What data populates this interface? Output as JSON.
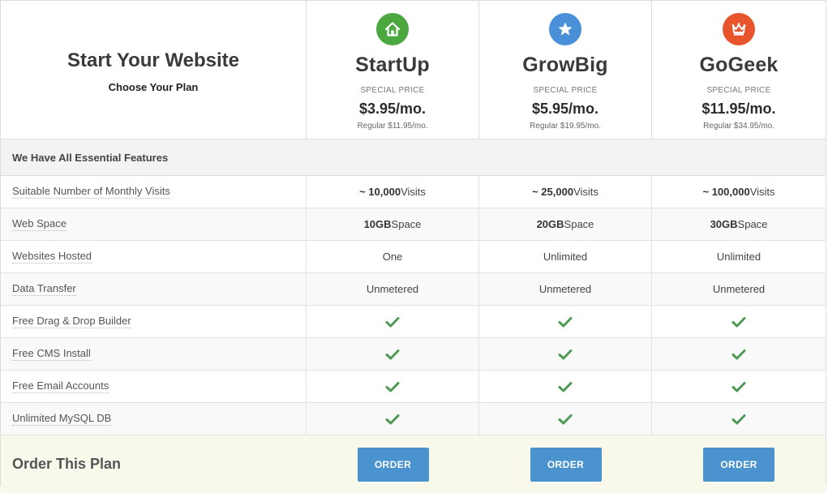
{
  "header": {
    "title": "Start Your Website",
    "subtitle": "Choose Your Plan"
  },
  "plans": [
    {
      "name": "StartUp",
      "icon": "house-icon",
      "icon_color": "#4aa83f",
      "special_label": "SPECIAL PRICE",
      "price": "$3.95/mo.",
      "regular": "Regular $11.95/mo."
    },
    {
      "name": "GrowBig",
      "icon": "star-icon",
      "icon_color": "#4a90d9",
      "special_label": "SPECIAL PRICE",
      "price": "$5.95/mo.",
      "regular": "Regular $19.95/mo."
    },
    {
      "name": "GoGeek",
      "icon": "crown-icon",
      "icon_color": "#e8542c",
      "special_label": "SPECIAL PRICE",
      "price": "$11.95/mo.",
      "regular": "Regular $34.95/mo."
    }
  ],
  "section_title": "We Have All Essential Features",
  "features": [
    {
      "label": "Suitable Number of Monthly Visits",
      "values": [
        {
          "bold": "~ 10,000",
          "rest": " Visits"
        },
        {
          "bold": "~ 25,000",
          "rest": " Visits"
        },
        {
          "bold": "~ 100,000",
          "rest": " Visits"
        }
      ]
    },
    {
      "label": "Web Space",
      "values": [
        {
          "bold": "10GB",
          "rest": " Space"
        },
        {
          "bold": "20GB",
          "rest": " Space"
        },
        {
          "bold": "30GB",
          "rest": " Space"
        }
      ]
    },
    {
      "label": "Websites Hosted",
      "values": [
        {
          "bold": "",
          "rest": "One"
        },
        {
          "bold": "",
          "rest": "Unlimited"
        },
        {
          "bold": "",
          "rest": "Unlimited"
        }
      ]
    },
    {
      "label": "Data Transfer",
      "values": [
        {
          "bold": "",
          "rest": "Unmetered"
        },
        {
          "bold": "",
          "rest": "Unmetered"
        },
        {
          "bold": "",
          "rest": "Unmetered"
        }
      ]
    },
    {
      "label": "Free Drag & Drop Builder",
      "check": true
    },
    {
      "label": "Free CMS Install",
      "check": true
    },
    {
      "label": "Free Email Accounts",
      "check": true
    },
    {
      "label": "Unlimited MySQL DB",
      "check": true
    }
  ],
  "check_color": "#4e9a55",
  "order": {
    "title": "Order This Plan",
    "button_label": "ORDER",
    "button_color": "#4a93cf"
  }
}
